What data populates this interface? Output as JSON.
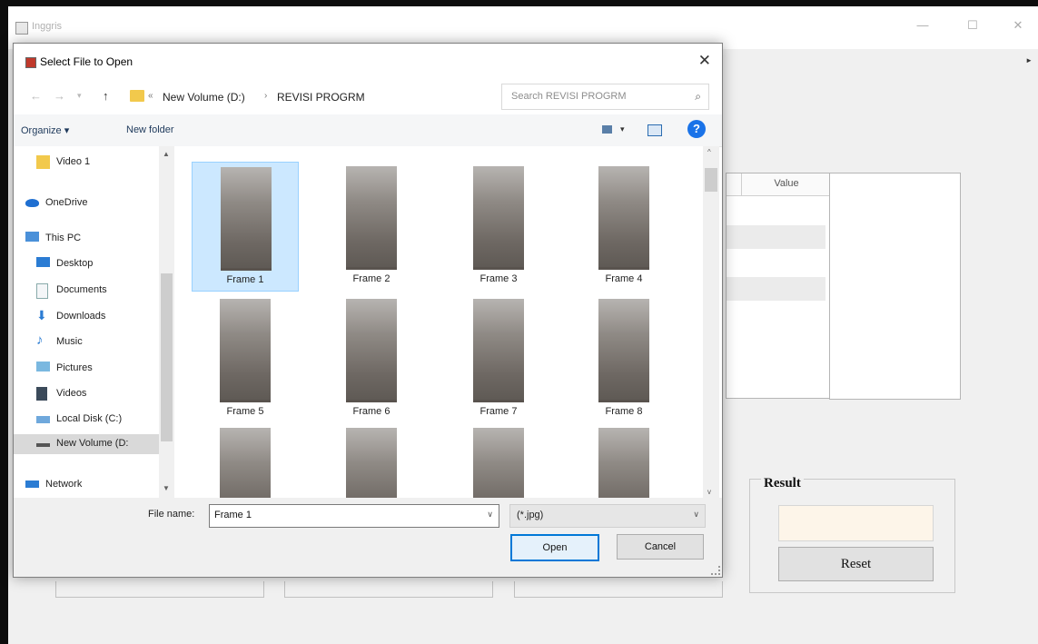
{
  "app": {
    "title": "Inggris",
    "minimize": "—",
    "maximize": "☐",
    "close": "✕",
    "table_header": "Value",
    "result_title": "Result",
    "reset_label": "Reset"
  },
  "dialog": {
    "title": "Select File to Open",
    "close": "✕",
    "breadcrumb": [
      "New Volume (D:)",
      "REVISI PROGRM"
    ],
    "search_placeholder": "Search REVISI PROGRM",
    "organize_label": "Organize ▾",
    "new_folder_label": "New folder",
    "help_label": "?",
    "nav_items": [
      {
        "label": "Video 1",
        "icon": "folder-icon"
      },
      {
        "label": "OneDrive",
        "icon": "cloud-icon"
      },
      {
        "label": "This PC",
        "icon": "computer-icon"
      },
      {
        "label": "Desktop",
        "icon": "desktop-icon"
      },
      {
        "label": "Documents",
        "icon": "documents-icon"
      },
      {
        "label": "Downloads",
        "icon": "downloads-icon"
      },
      {
        "label": "Music",
        "icon": "music-icon"
      },
      {
        "label": "Pictures",
        "icon": "pictures-icon"
      },
      {
        "label": "Videos",
        "icon": "videos-icon"
      },
      {
        "label": "Local Disk (C:)",
        "icon": "drive-icon"
      },
      {
        "label": "New Volume (D:",
        "icon": "drive-icon",
        "selected": true
      },
      {
        "label": "Network",
        "icon": "network-icon"
      }
    ],
    "files": [
      "Frame 1",
      "Frame 2",
      "Frame 3",
      "Frame 4",
      "Frame 5",
      "Frame 6",
      "Frame 7",
      "Frame 8",
      "",
      "",
      "",
      ""
    ],
    "selected_file": "Frame 1",
    "file_name_label": "File name:",
    "file_name_value": "Frame 1",
    "file_type_value": "(*.jpg)",
    "open_label": "Open",
    "cancel_label": "Cancel"
  },
  "colors": {
    "selection": "#cce8ff",
    "accent": "#0078d7",
    "result_field": "#fdf5e9"
  }
}
